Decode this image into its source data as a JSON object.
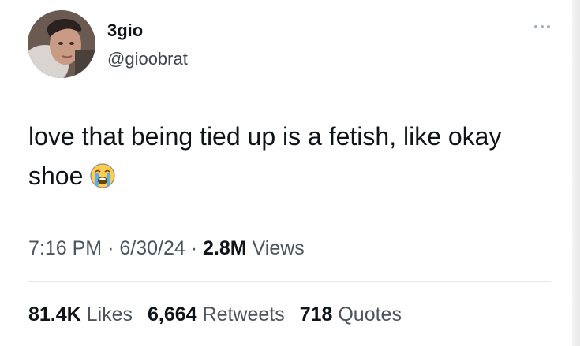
{
  "user": {
    "display_name": "3gio",
    "handle": "@gioobrat",
    "avatar_icon": "profile-photo"
  },
  "more_icon": "ellipsis-icon",
  "tweet": {
    "text": "love that being tied up is a fetish, like okay shoe",
    "emoji": "loudly-crying-face"
  },
  "meta": {
    "time": "7:16 PM",
    "separator": "·",
    "date": "6/30/24",
    "views_count": "2.8M",
    "views_label": "Views"
  },
  "stats": {
    "likes_count": "81.4K",
    "likes_label": "Likes",
    "retweets_count": "6,664",
    "retweets_label": "Retweets",
    "quotes_count": "718",
    "quotes_label": "Quotes"
  },
  "colors": {
    "text_primary": "#0f1419",
    "text_secondary": "#4b5560",
    "divider": "#e3e7ea"
  }
}
